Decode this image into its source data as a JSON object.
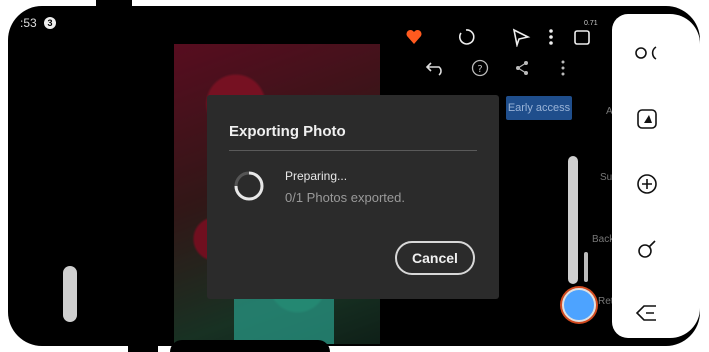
{
  "status_bar": {
    "time": ":53",
    "notification_count": "3",
    "right_text": "0.71"
  },
  "toolbar": {
    "icons": [
      "heart-icon",
      "undo-circle-icon",
      "send-icon",
      "more-icon",
      "crop-icon"
    ],
    "secondary": [
      "undo-icon",
      "help-icon",
      "share-icon",
      "more-vertical-icon"
    ]
  },
  "early_access": {
    "label": "Early access"
  },
  "side_labels": {
    "a": "A",
    "sub": "Sub",
    "backg": "Backg",
    "retc": "Retc"
  },
  "dialog": {
    "title": "Exporting Photo",
    "status": "Preparing...",
    "progress": "0/1 Photos exported.",
    "cancel_label": "Cancel"
  },
  "right_panel": {
    "icons": [
      "link-icon",
      "photo-adjust-icon",
      "add-circle-icon",
      "lasso-icon",
      "eraser-icon"
    ]
  },
  "colors": {
    "accent_blue": "#4da3ff",
    "dialog_bg": "#2b2b2b",
    "early_bg": "#1f4e8c"
  }
}
